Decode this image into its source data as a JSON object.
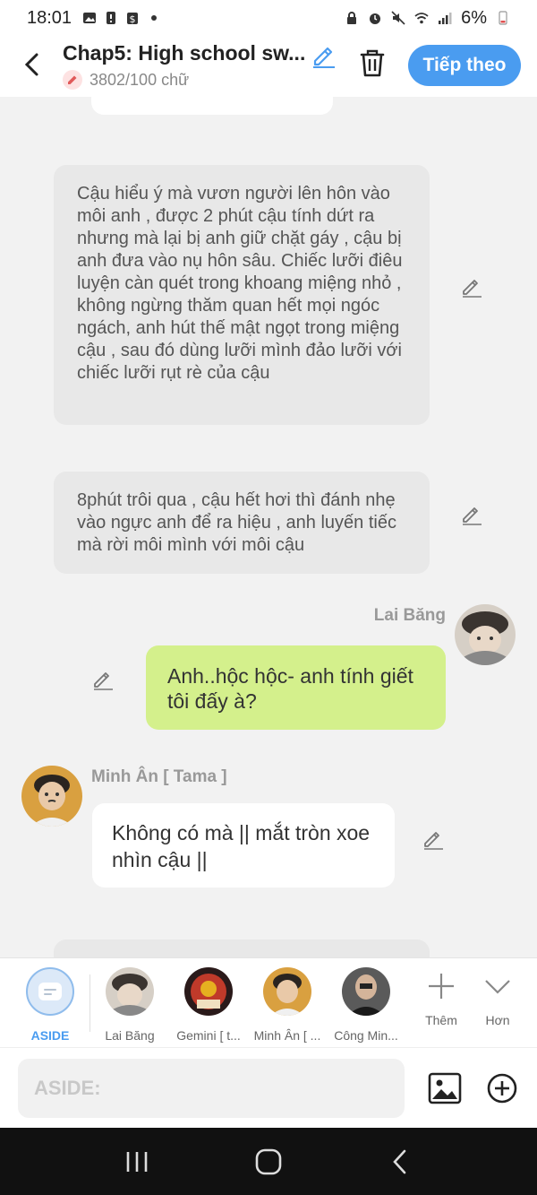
{
  "status_bar": {
    "time": "18:01",
    "battery": "6%"
  },
  "header": {
    "title": "Chap5: High school sw...",
    "word_count": "3802/100 chữ",
    "next_label": "Tiếp theo"
  },
  "messages": {
    "aside1": "Cậu hiểu ý mà vươn người lên hôn vào môi anh , được 2 phút cậu tính dứt ra nhưng mà lại bị anh giữ chặt gáy , cậu bị anh đưa vào nụ hôn sâu. Chiếc lưỡi điêu luyện càn quét trong khoang miệng nhỏ , không ngừng thăm quan hết mọi ngóc ngách, anh hút thế mật ngọt trong miệng cậu , sau đó dùng lưỡi mình đảo lưỡi với chiếc lưỡi rụt rè của cậu",
    "aside2": "8phút trôi qua , cậu hết hơi thì đánh nhẹ vào ngực anh để ra hiệu , anh luyến tiếc mà rời môi mình với môi cậu",
    "msg1": {
      "sender": "Lai Băng",
      "text": "Anh..hộc hộc- anh tính giết tôi đấy à?"
    },
    "msg2": {
      "sender": "Minh Ân [ Tama ]",
      "text": "Không có mà || mắt tròn xoe nhìn cậu ||"
    }
  },
  "characters": [
    {
      "label": "ASIDE"
    },
    {
      "label": "Lai Băng"
    },
    {
      "label": "Gemini [ t..."
    },
    {
      "label": "Minh Ân [ ..."
    },
    {
      "label": "Công Min..."
    }
  ],
  "tools": {
    "more_label": "Thêm",
    "collapse_label": "Hơn"
  },
  "input": {
    "placeholder": "ASIDE:"
  },
  "colors": {
    "accent": "#4a9cf0",
    "green_bubble": "#d4f08c",
    "aside_bubble": "#e8e8e8"
  }
}
